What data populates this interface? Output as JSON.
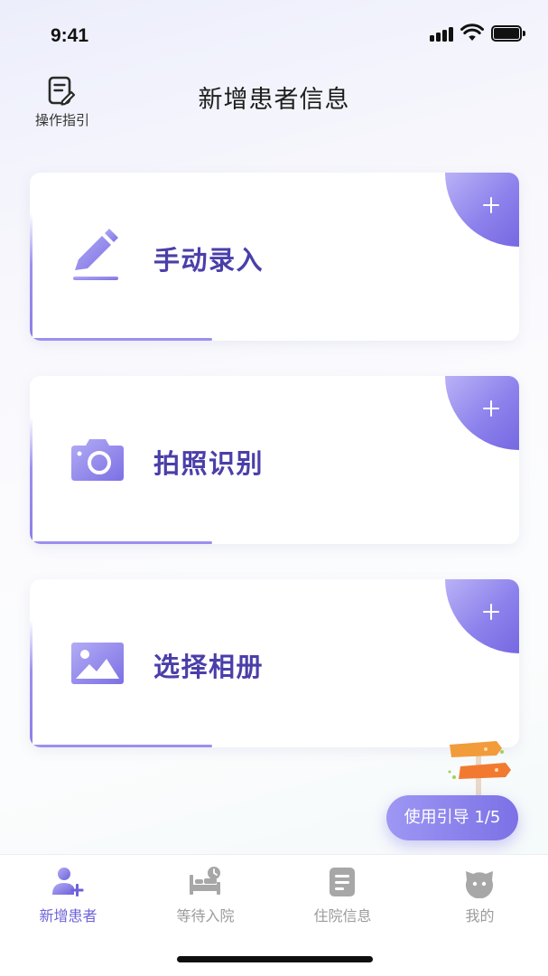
{
  "status_bar": {
    "time": "9:41"
  },
  "header": {
    "guide_label": "操作指引",
    "title": "新增患者信息"
  },
  "cards": [
    {
      "label": "手动录入",
      "icon": "pencil-icon"
    },
    {
      "label": "拍照识别",
      "icon": "camera-icon"
    },
    {
      "label": "选择相册",
      "icon": "album-icon"
    }
  ],
  "floating_guide": {
    "label": "使用引导 1/5"
  },
  "tabs": [
    {
      "label": "新增患者",
      "icon": "add-user-icon",
      "active": true
    },
    {
      "label": "等待入院",
      "icon": "bed-clock-icon",
      "active": false
    },
    {
      "label": "住院信息",
      "icon": "document-icon",
      "active": false
    },
    {
      "label": "我的",
      "icon": "face-icon",
      "active": false
    }
  ],
  "colors": {
    "accent": "#7c71e6",
    "card_text": "#4a3fa9",
    "tab_active": "#6d62d9",
    "tab_inactive": "#9b9b9b"
  }
}
